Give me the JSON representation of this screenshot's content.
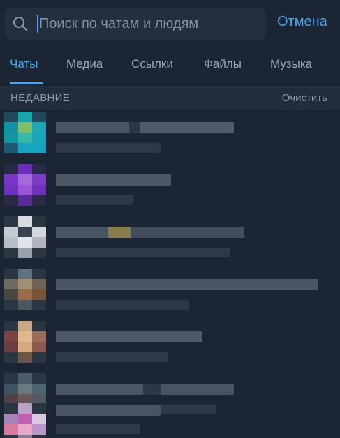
{
  "search": {
    "placeholder": "Поиск по чатам и людям",
    "cancel_label": "Отмена"
  },
  "tabs": [
    {
      "label": "Чаты",
      "active": true
    },
    {
      "label": "Медиа",
      "active": false
    },
    {
      "label": "Ссылки",
      "active": false
    },
    {
      "label": "Файлы",
      "active": false
    },
    {
      "label": "Музыка",
      "active": false
    }
  ],
  "recent": {
    "title": "НЕДАВНИЕ",
    "clear_label": "Очистить"
  },
  "colors": {
    "background": "#1c2533",
    "accent": "#4ba6ee",
    "search_field": "#242f3d",
    "section_header": "#222c3a",
    "muted_text": "#8d9aab"
  }
}
